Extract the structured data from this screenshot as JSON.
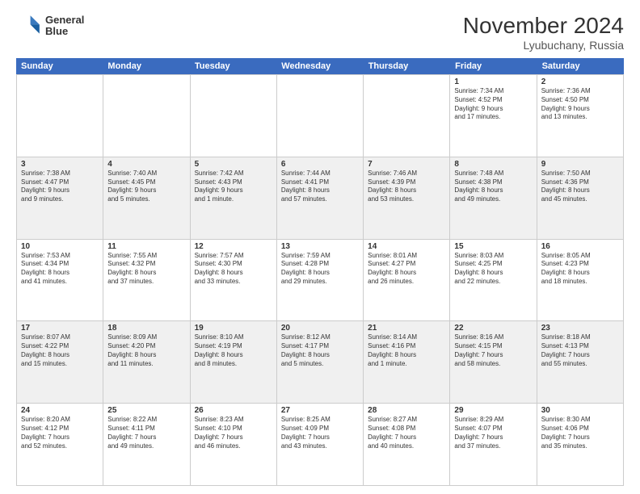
{
  "header": {
    "logo_line1": "General",
    "logo_line2": "Blue",
    "title": "November 2024",
    "subtitle": "Lyubuchany, Russia"
  },
  "calendar": {
    "days_of_week": [
      "Sunday",
      "Monday",
      "Tuesday",
      "Wednesday",
      "Thursday",
      "Friday",
      "Saturday"
    ],
    "weeks": [
      [
        {
          "day": "",
          "info": ""
        },
        {
          "day": "",
          "info": ""
        },
        {
          "day": "",
          "info": ""
        },
        {
          "day": "",
          "info": ""
        },
        {
          "day": "",
          "info": ""
        },
        {
          "day": "1",
          "info": "Sunrise: 7:34 AM\nSunset: 4:52 PM\nDaylight: 9 hours\nand 17 minutes."
        },
        {
          "day": "2",
          "info": "Sunrise: 7:36 AM\nSunset: 4:50 PM\nDaylight: 9 hours\nand 13 minutes."
        }
      ],
      [
        {
          "day": "3",
          "info": "Sunrise: 7:38 AM\nSunset: 4:47 PM\nDaylight: 9 hours\nand 9 minutes."
        },
        {
          "day": "4",
          "info": "Sunrise: 7:40 AM\nSunset: 4:45 PM\nDaylight: 9 hours\nand 5 minutes."
        },
        {
          "day": "5",
          "info": "Sunrise: 7:42 AM\nSunset: 4:43 PM\nDaylight: 9 hours\nand 1 minute."
        },
        {
          "day": "6",
          "info": "Sunrise: 7:44 AM\nSunset: 4:41 PM\nDaylight: 8 hours\nand 57 minutes."
        },
        {
          "day": "7",
          "info": "Sunrise: 7:46 AM\nSunset: 4:39 PM\nDaylight: 8 hours\nand 53 minutes."
        },
        {
          "day": "8",
          "info": "Sunrise: 7:48 AM\nSunset: 4:38 PM\nDaylight: 8 hours\nand 49 minutes."
        },
        {
          "day": "9",
          "info": "Sunrise: 7:50 AM\nSunset: 4:36 PM\nDaylight: 8 hours\nand 45 minutes."
        }
      ],
      [
        {
          "day": "10",
          "info": "Sunrise: 7:53 AM\nSunset: 4:34 PM\nDaylight: 8 hours\nand 41 minutes."
        },
        {
          "day": "11",
          "info": "Sunrise: 7:55 AM\nSunset: 4:32 PM\nDaylight: 8 hours\nand 37 minutes."
        },
        {
          "day": "12",
          "info": "Sunrise: 7:57 AM\nSunset: 4:30 PM\nDaylight: 8 hours\nand 33 minutes."
        },
        {
          "day": "13",
          "info": "Sunrise: 7:59 AM\nSunset: 4:28 PM\nDaylight: 8 hours\nand 29 minutes."
        },
        {
          "day": "14",
          "info": "Sunrise: 8:01 AM\nSunset: 4:27 PM\nDaylight: 8 hours\nand 26 minutes."
        },
        {
          "day": "15",
          "info": "Sunrise: 8:03 AM\nSunset: 4:25 PM\nDaylight: 8 hours\nand 22 minutes."
        },
        {
          "day": "16",
          "info": "Sunrise: 8:05 AM\nSunset: 4:23 PM\nDaylight: 8 hours\nand 18 minutes."
        }
      ],
      [
        {
          "day": "17",
          "info": "Sunrise: 8:07 AM\nSunset: 4:22 PM\nDaylight: 8 hours\nand 15 minutes."
        },
        {
          "day": "18",
          "info": "Sunrise: 8:09 AM\nSunset: 4:20 PM\nDaylight: 8 hours\nand 11 minutes."
        },
        {
          "day": "19",
          "info": "Sunrise: 8:10 AM\nSunset: 4:19 PM\nDaylight: 8 hours\nand 8 minutes."
        },
        {
          "day": "20",
          "info": "Sunrise: 8:12 AM\nSunset: 4:17 PM\nDaylight: 8 hours\nand 5 minutes."
        },
        {
          "day": "21",
          "info": "Sunrise: 8:14 AM\nSunset: 4:16 PM\nDaylight: 8 hours\nand 1 minute."
        },
        {
          "day": "22",
          "info": "Sunrise: 8:16 AM\nSunset: 4:15 PM\nDaylight: 7 hours\nand 58 minutes."
        },
        {
          "day": "23",
          "info": "Sunrise: 8:18 AM\nSunset: 4:13 PM\nDaylight: 7 hours\nand 55 minutes."
        }
      ],
      [
        {
          "day": "24",
          "info": "Sunrise: 8:20 AM\nSunset: 4:12 PM\nDaylight: 7 hours\nand 52 minutes."
        },
        {
          "day": "25",
          "info": "Sunrise: 8:22 AM\nSunset: 4:11 PM\nDaylight: 7 hours\nand 49 minutes."
        },
        {
          "day": "26",
          "info": "Sunrise: 8:23 AM\nSunset: 4:10 PM\nDaylight: 7 hours\nand 46 minutes."
        },
        {
          "day": "27",
          "info": "Sunrise: 8:25 AM\nSunset: 4:09 PM\nDaylight: 7 hours\nand 43 minutes."
        },
        {
          "day": "28",
          "info": "Sunrise: 8:27 AM\nSunset: 4:08 PM\nDaylight: 7 hours\nand 40 minutes."
        },
        {
          "day": "29",
          "info": "Sunrise: 8:29 AM\nSunset: 4:07 PM\nDaylight: 7 hours\nand 37 minutes."
        },
        {
          "day": "30",
          "info": "Sunrise: 8:30 AM\nSunset: 4:06 PM\nDaylight: 7 hours\nand 35 minutes."
        }
      ]
    ]
  }
}
